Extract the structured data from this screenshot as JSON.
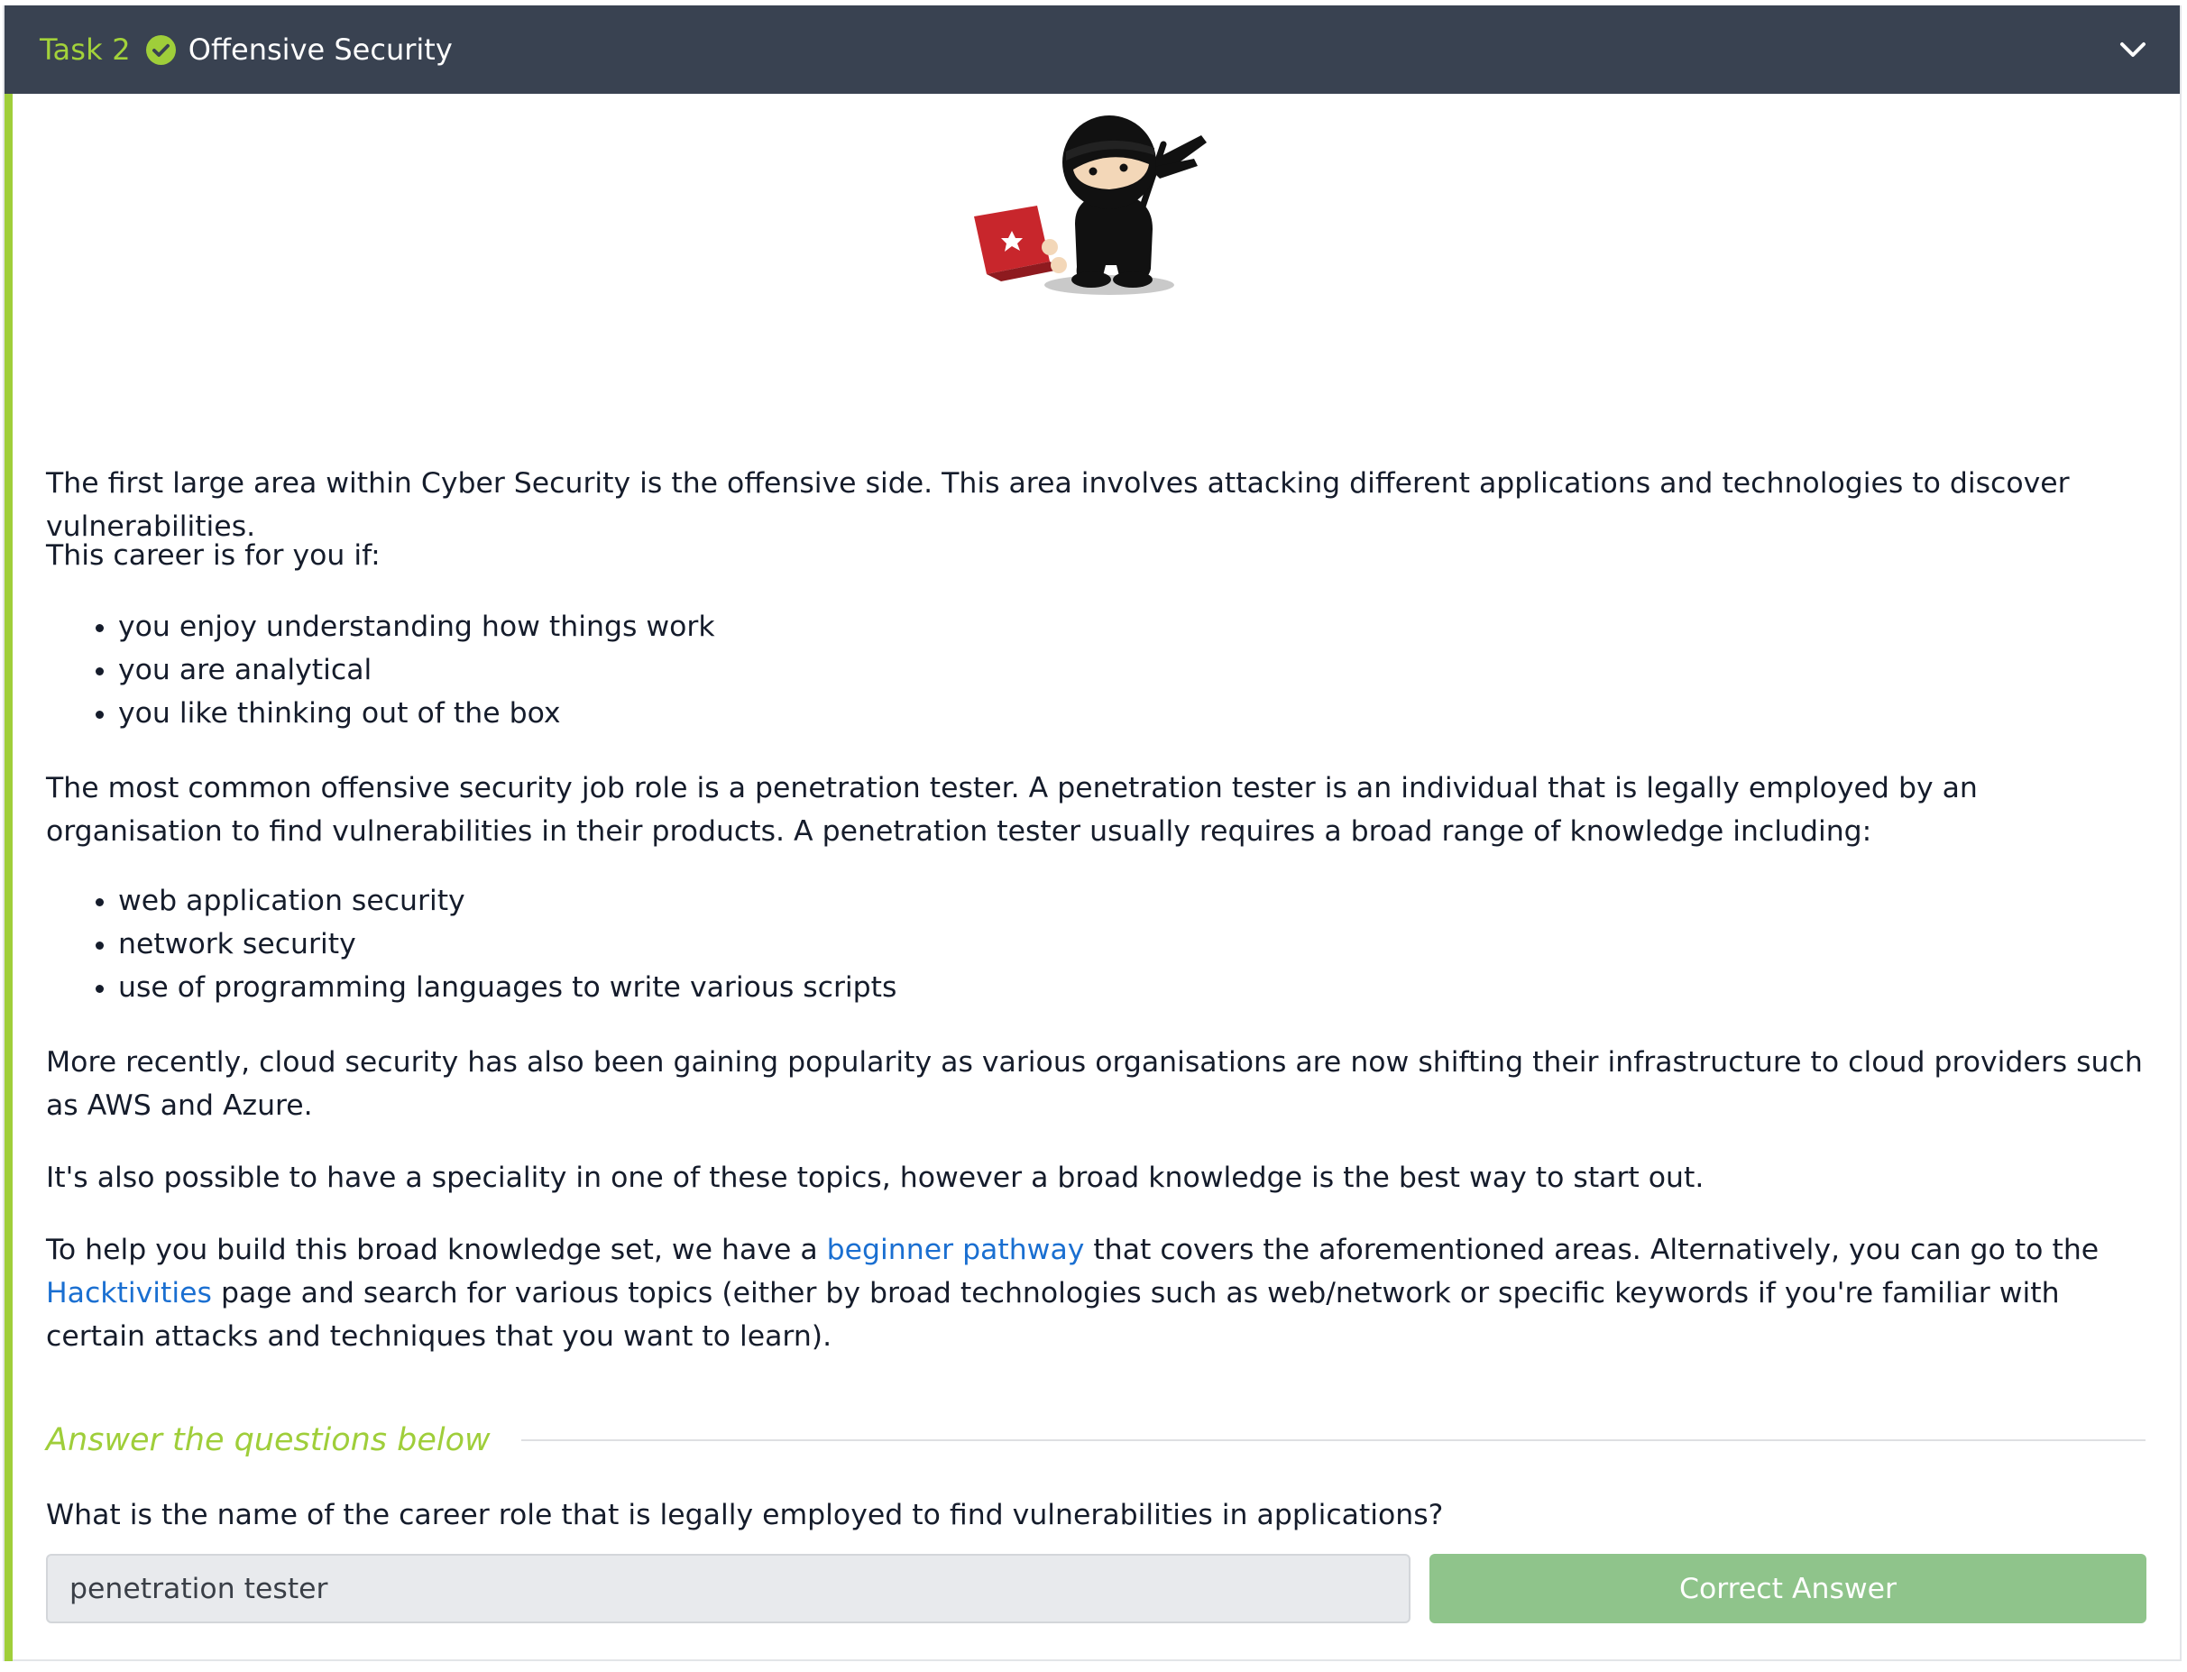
{
  "header": {
    "task_number": "Task 2",
    "title": "Offensive Security"
  },
  "content": {
    "intro": "The first large area within Cyber Security is the offensive side. This area involves attacking different applications and technologies to discover vulnerabilities.",
    "career_intro": "This career is for you if:",
    "traits": [
      "you enjoy understanding how things work",
      "you are analytical",
      "you like thinking out of the box"
    ],
    "pentester_paragraph": "The most common offensive security job role is a penetration tester. A penetration tester is an individual that is legally employed by an organisation to find vulnerabilities in their products. A penetration tester usually requires a broad range of knowledge including:",
    "knowledge_areas": [
      "web application security",
      "network security",
      "use of programming languages to write various scripts"
    ],
    "cloud_paragraph": "More recently, cloud security has also been gaining popularity as various organisations are now shifting their infrastructure to cloud providers such as AWS and Azure.",
    "speciality_paragraph": "It's also possible to have a speciality in one of these topics, however a broad knowledge is the best way to start out.",
    "pathway_paragraph": {
      "part1": "To help you build this broad knowledge set, we have a ",
      "link1": "beginner pathway",
      "part2": " that covers the aforementioned areas. Alternatively, you can go to the ",
      "link2": "Hacktivities",
      "part3": " page and search for various topics (either by broad technologies such as web/network or specific keywords if you're familiar with certain attacks and techniques that you want to learn)."
    }
  },
  "questions": {
    "section_title": "Answer the questions below",
    "question": "What is the name of the career role that is legally employed to find vulnerabilities in applications?",
    "answer_value": "penetration tester",
    "button_label": "Correct Answer"
  },
  "colors": {
    "header_bg": "#394251",
    "accent_green": "#9fce3a",
    "link_blue": "#1a6fd1",
    "button_green": "#8fc48b"
  },
  "icons": {
    "status": "check-circle-icon",
    "collapse": "chevron-down-icon",
    "illustration": "ninja-with-laptop"
  }
}
